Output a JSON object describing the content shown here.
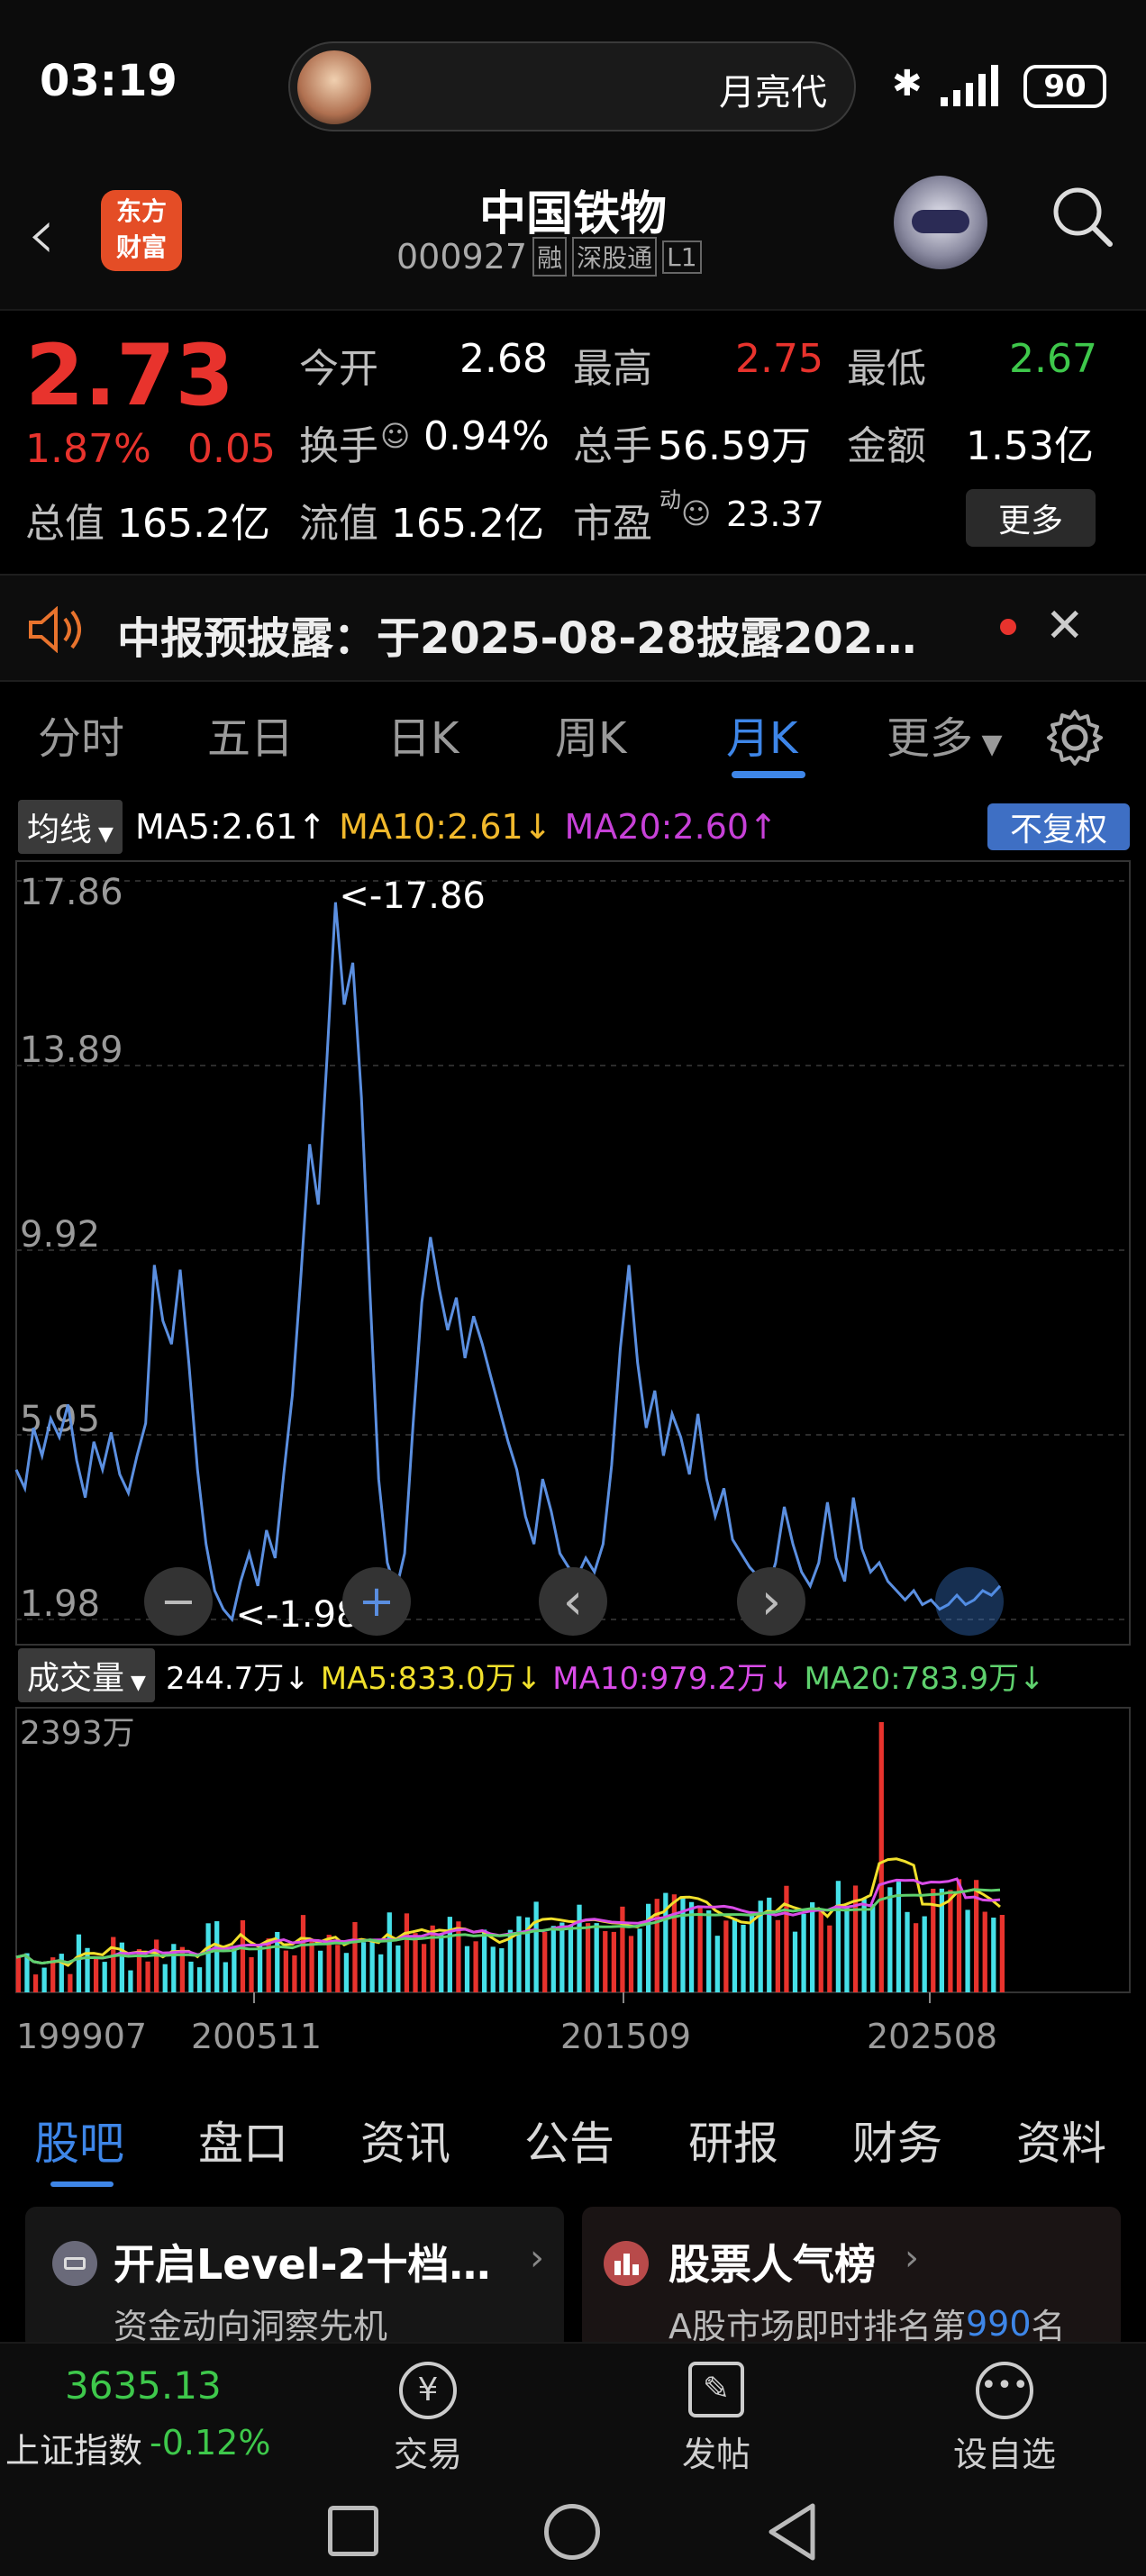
{
  "status_bar": {
    "time": "03:19",
    "island_text": "月亮代",
    "battery": "90"
  },
  "header": {
    "title": "中国铁物",
    "code": "000927",
    "tags": [
      "融",
      "深股通",
      "L1"
    ],
    "logo_text": [
      "东方",
      "财富"
    ]
  },
  "quote": {
    "price": "2.73",
    "change_pct": "1.87%",
    "change": "0.05",
    "rows": [
      [
        {
          "label": "今开",
          "value": "2.68"
        },
        {
          "label": "最高",
          "value": "2.75"
        },
        {
          "label": "最低",
          "value": "2.67"
        }
      ],
      [
        {
          "label": "换手",
          "value": "0.94%"
        },
        {
          "label": "总手",
          "value": "56.59万"
        },
        {
          "label": "金额",
          "value": "1.53亿"
        }
      ],
      [
        {
          "label": "总值",
          "value": "165.2亿"
        },
        {
          "label": "流值",
          "value": "165.2亿"
        },
        {
          "label": "市盈",
          "value": "23.37"
        }
      ]
    ],
    "pe_superscript": "动",
    "more_button": "更多"
  },
  "notice": {
    "text": "中报预披露：于2025-08-28披露202…"
  },
  "period_tabs": {
    "items": [
      "分时",
      "五日",
      "日K",
      "周K",
      "月K",
      "更多"
    ],
    "active": 4
  },
  "ma_legend": {
    "label": "均线",
    "ma5": "MA5:2.61",
    "ma10": "MA10:2.61",
    "ma20": "MA20:2.60",
    "adjust": "不复权"
  },
  "kline": {
    "y_ticks": [
      "17.86",
      "13.89",
      "9.92",
      "5.95",
      "1.98"
    ],
    "max_label": "<-17.86",
    "min_label": "<-1.98",
    "x_ticks": [
      "199907",
      "200511",
      "201509",
      "202508"
    ]
  },
  "volume_legend": {
    "label": "成交量",
    "vol": "244.7万",
    "ma5": "MA5:833.0万",
    "ma10": "MA10:979.2万",
    "ma20": "MA20:783.9万",
    "max_tick": "2393万"
  },
  "chart_data": {
    "type": "line",
    "title": "",
    "xlabel": "",
    "ylabel": "",
    "ylim": [
      1.98,
      17.86
    ],
    "x_ticks": [
      "199907",
      "200511",
      "201509",
      "202508"
    ],
    "series": [
      {
        "values": [
          5.2,
          4.8,
          6.1,
          5.5,
          6.3,
          5.9,
          6.6,
          5.4,
          4.6,
          5.8,
          5.2,
          6.0,
          5.1,
          4.7,
          5.5,
          6.2,
          9.6,
          8.4,
          7.9,
          9.5,
          7.5,
          5.2,
          3.6,
          2.6,
          2.2,
          1.98,
          2.8,
          3.4,
          2.7,
          3.9,
          3.3,
          5.1,
          6.8,
          9.4,
          12.2,
          10.9,
          14.0,
          17.4,
          15.2,
          16.1,
          13.2,
          9.0,
          5.0,
          3.2,
          2.6,
          3.4,
          6.2,
          8.8,
          10.2,
          9.1,
          8.2,
          8.9,
          7.6,
          8.5,
          7.9,
          7.2,
          6.5,
          5.8,
          5.2,
          4.2,
          3.6,
          5.0,
          4.3,
          3.4,
          3.1,
          2.9,
          3.3,
          3.0,
          3.6,
          5.3,
          7.8,
          9.6,
          7.5,
          6.1,
          6.9,
          5.5,
          6.4,
          5.9,
          5.1,
          6.4,
          5.0,
          4.2,
          4.8,
          3.7,
          3.4,
          3.1,
          2.9,
          2.6,
          3.2,
          4.4,
          3.6,
          3.0,
          2.7,
          3.2,
          4.5,
          3.3,
          2.8,
          4.6,
          3.5,
          3.0,
          3.2,
          2.8,
          2.6,
          2.4,
          2.6,
          2.3,
          2.4,
          2.2,
          2.3,
          2.5,
          2.3,
          2.4,
          2.6,
          2.5,
          2.7
        ]
      }
    ]
  },
  "chart_controls": {
    "zoom_out": "−",
    "zoom_in": "+",
    "prev": "‹",
    "next": "›"
  },
  "bottom_tabs": {
    "items": [
      "股吧",
      "盘口",
      "资讯",
      "公告",
      "研报",
      "财务",
      "资料"
    ],
    "active": 0
  },
  "cards": [
    {
      "title": "开启Level-2十档…",
      "sub": "资金动向洞察先机"
    },
    {
      "title": "股票人气榜",
      "sub_prefix": "A股市场即时排名第",
      "rank": "990",
      "sub_suffix": "名"
    }
  ],
  "bottom_bar": {
    "index_value": "3635.13",
    "index_name": "上证指数",
    "index_change": "-0.12%",
    "actions": [
      {
        "label": "交易"
      },
      {
        "label": "发帖"
      },
      {
        "label": "设自选"
      }
    ]
  },
  "colors": {
    "up": "#e8332d",
    "down": "#3ec84b",
    "accent": "#3e86e8",
    "ma10": "#f1b92c",
    "ma20": "#c741d8",
    "vol_ma20": "#5fd16e"
  }
}
